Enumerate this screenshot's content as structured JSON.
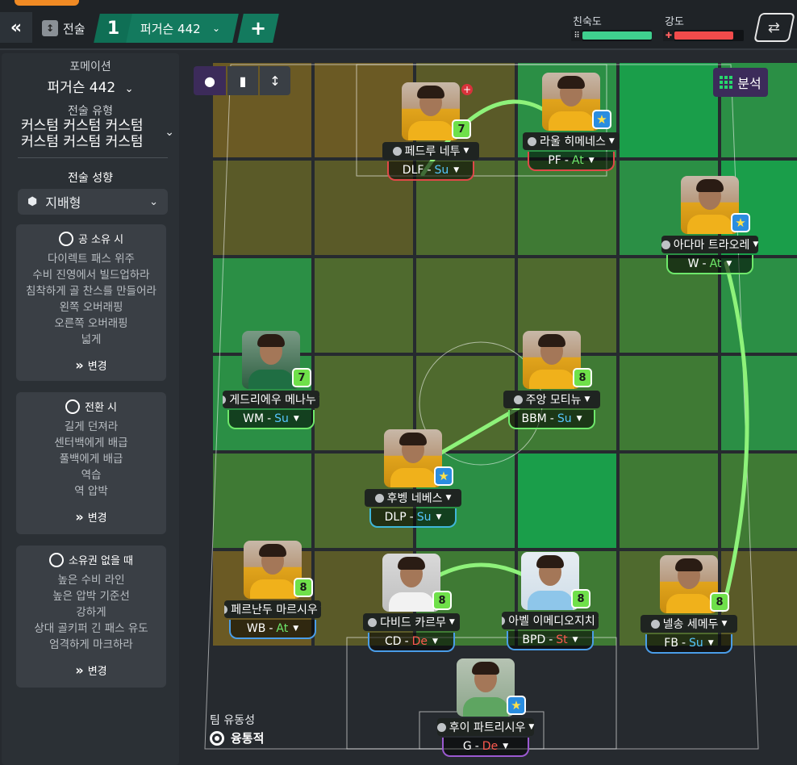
{
  "topbar": {
    "tactic_label": "전술",
    "tactic_number": "1",
    "formation": "퍼거슨  442",
    "add": "+",
    "familiarity_label": "친숙도",
    "familiarity_value": 1.0,
    "intensity_label": "강도",
    "intensity_value": 0.85
  },
  "left": {
    "formation_label": "포메이션",
    "formation_value": "퍼거슨  442",
    "style_label": "전술 유형",
    "style_line1": "커스텀 커스텀 커스텀",
    "style_line2": "커스텀 커스텀 커스텀",
    "mentality_label": "전술 성향",
    "mentality_value": "지배형",
    "in_possession": {
      "title": "공 소유 시",
      "items": [
        "다이렉트 패스 위주",
        "수비 진영에서 빌드업하라",
        "침착하게 골 찬스를 만들어라",
        "왼쪽 오버래핑",
        "오른쪽 오버래핑",
        "넓게"
      ],
      "change": "변경"
    },
    "in_transition": {
      "title": "전환 시",
      "items": [
        "길게 던져라",
        "센터백에게 배급",
        "풀백에게 배급",
        "역습",
        "역 압박"
      ],
      "change": "변경"
    },
    "out_of_possession": {
      "title": "소유권 없을 때",
      "items": [
        "높은 수비 라인",
        "높은 압박 기준선",
        "강하게",
        "상대 골키퍼 긴 패스 유도",
        "엄격하게 마크하라"
      ],
      "change": "변경"
    }
  },
  "pitch": {
    "analysis": "분석",
    "fluidity_label": "팀 유동성",
    "fluidity_value": "융통적"
  },
  "players": [
    {
      "name": "페드루 네투",
      "pos": "DLF",
      "duty": "Su",
      "duty_class": "duty-su",
      "badge": "7",
      "badge_type": "num",
      "border": "#e04848",
      "red": true,
      "photo": ""
    },
    {
      "name": "라울 히메네스",
      "pos": "PF",
      "duty": "At",
      "duty_class": "duty-at",
      "badge": "★",
      "badge_type": "star",
      "border": "#e04848",
      "photo": ""
    },
    {
      "name": "아다마 트라오레",
      "pos": "W",
      "duty": "At",
      "duty_class": "duty-at",
      "badge": "★",
      "badge_type": "star",
      "border": "#6ee86b",
      "photo": ""
    },
    {
      "name": "게드리에우 메나누",
      "pos": "WM",
      "duty": "Su",
      "duty_class": "duty-su",
      "badge": "7",
      "badge_type": "num",
      "border": "#6ee86b",
      "photo": "away"
    },
    {
      "name": "주앙 모티뉴",
      "pos": "BBM",
      "duty": "Su",
      "duty_class": "duty-su",
      "badge": "8",
      "badge_type": "num",
      "border": "#6ee86b",
      "photo": ""
    },
    {
      "name": "후벵 네베스",
      "pos": "DLP",
      "duty": "Su",
      "duty_class": "duty-su",
      "badge": "★",
      "badge_type": "star",
      "border": "#3fb6d8",
      "photo": ""
    },
    {
      "name": "페르난두 마르시우",
      "pos": "WB",
      "duty": "At",
      "duty_class": "duty-at",
      "badge": "8",
      "badge_type": "num",
      "border": "#4a9de8",
      "photo": ""
    },
    {
      "name": "다비드 카르무",
      "pos": "CD",
      "duty": "De",
      "duty_class": "duty-de",
      "badge": "8",
      "badge_type": "num",
      "border": "#4a9de8",
      "photo": "white"
    },
    {
      "name": "아벨 이메디오지치",
      "pos": "BPD",
      "duty": "St",
      "duty_class": "duty-st",
      "badge": "8",
      "badge_type": "num",
      "border": "#4a9de8",
      "photo": "sky"
    },
    {
      "name": "넬송 세메두",
      "pos": "FB",
      "duty": "Su",
      "duty_class": "duty-su",
      "badge": "8",
      "badge_type": "num",
      "border": "#4a9de8",
      "photo": ""
    },
    {
      "name": "후이 파트리시우",
      "pos": "G",
      "duty": "De",
      "duty_class": "duty-de",
      "badge": "★",
      "badge_type": "star",
      "border": "#9b59d0",
      "photo": "keeper"
    }
  ],
  "colors": {
    "accent_green": "#137a5e",
    "analysis_purple": "#3c2b5a",
    "familiarity_fill": "#3fcf8e",
    "intensity_fill": "#f04b4b"
  }
}
